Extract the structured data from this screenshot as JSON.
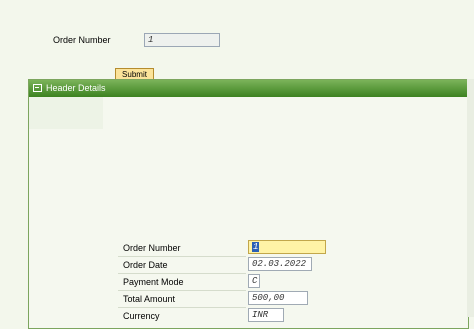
{
  "search": {
    "label": "Order Number",
    "value": "1",
    "submit_label": "Submit"
  },
  "panel": {
    "title": "Header Details"
  },
  "fields": [
    {
      "label": "Order Number",
      "value": "1"
    },
    {
      "label": "Order Date",
      "value": "02.03.2022"
    },
    {
      "label": "Payment Mode",
      "value": "C"
    },
    {
      "label": "Total Amount",
      "value": "500,00"
    },
    {
      "label": "Currency",
      "value": "INR"
    }
  ],
  "colors": {
    "header_green": "#4c8f2c",
    "focus_yellow": "#fff3a6",
    "submit_yellow": "#fbe39a"
  }
}
